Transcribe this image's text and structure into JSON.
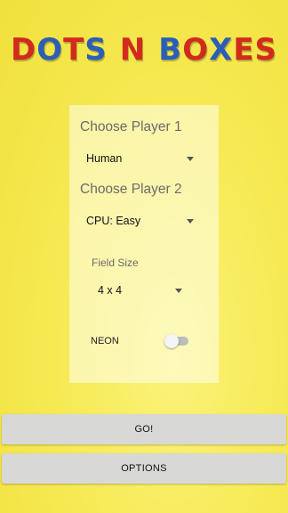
{
  "header": {
    "title_letters": [
      {
        "ch": "D",
        "color": "#d32a1e"
      },
      {
        "ch": "O",
        "color": "#2a5fb8"
      },
      {
        "ch": "T",
        "color": "#d32a1e"
      },
      {
        "ch": "S",
        "color": "#2a5fb8"
      },
      {
        "ch": " ",
        "color": ""
      },
      {
        "ch": "N",
        "color": "#d32a1e"
      },
      {
        "ch": " ",
        "color": ""
      },
      {
        "ch": "B",
        "color": "#2a5fb8"
      },
      {
        "ch": "O",
        "color": "#d32a1e"
      },
      {
        "ch": "X",
        "color": "#2a5fb8"
      },
      {
        "ch": "E",
        "color": "#d32a1e"
      },
      {
        "ch": "S",
        "color": "#d32a1e"
      }
    ]
  },
  "settings": {
    "player1_label": "Choose Player 1",
    "player1_value": "Human",
    "player2_label": "Choose Player 2",
    "player2_value": "CPU: Easy",
    "field_size_label": "Field Size",
    "field_size_value": "4 x 4",
    "neon_label": "NEON",
    "neon_enabled": false
  },
  "actions": {
    "go_label": "GO!",
    "options_label": "OPTIONS"
  },
  "colors": {
    "background": "#f6ea55",
    "button": "#d8d8d6"
  }
}
